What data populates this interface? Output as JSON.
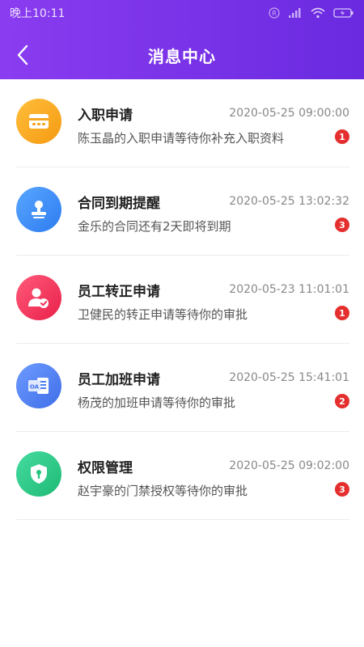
{
  "status_bar": {
    "time": "晚上10:11"
  },
  "header": {
    "title": "消息中心"
  },
  "messages": [
    {
      "title": "入职申请",
      "time": "2020-05-25  09:00:00",
      "desc": "陈玉晶的入职申请等待你补充入职资料",
      "badge": "1",
      "icon": "id-card-icon",
      "color": "#f7a121"
    },
    {
      "title": "合同到期提醒",
      "time": "2020-05-25  13:02:32",
      "desc": "金乐的合同还有2天即将到期",
      "badge": "3",
      "icon": "stamp-icon",
      "color": "#3b8cf6"
    },
    {
      "title": "员工转正申请",
      "time": "2020-05-23  11:01:01",
      "desc": "卫健民的转正申请等待你的审批",
      "badge": "1",
      "icon": "user-check-icon",
      "color": "#f2345c"
    },
    {
      "title": "员工加班申请",
      "time": "2020-05-25  15:41:01",
      "desc": "杨茂的加班申请等待你的审批",
      "badge": "2",
      "icon": "oa-document-icon",
      "color": "#4a7ff0"
    },
    {
      "title": "权限管理",
      "time": "2020-05-25  09:02:00",
      "desc": "赵宇豪的门禁授权等待你的审批",
      "badge": "3",
      "icon": "shield-key-icon",
      "color": "#2ecc8a"
    }
  ]
}
